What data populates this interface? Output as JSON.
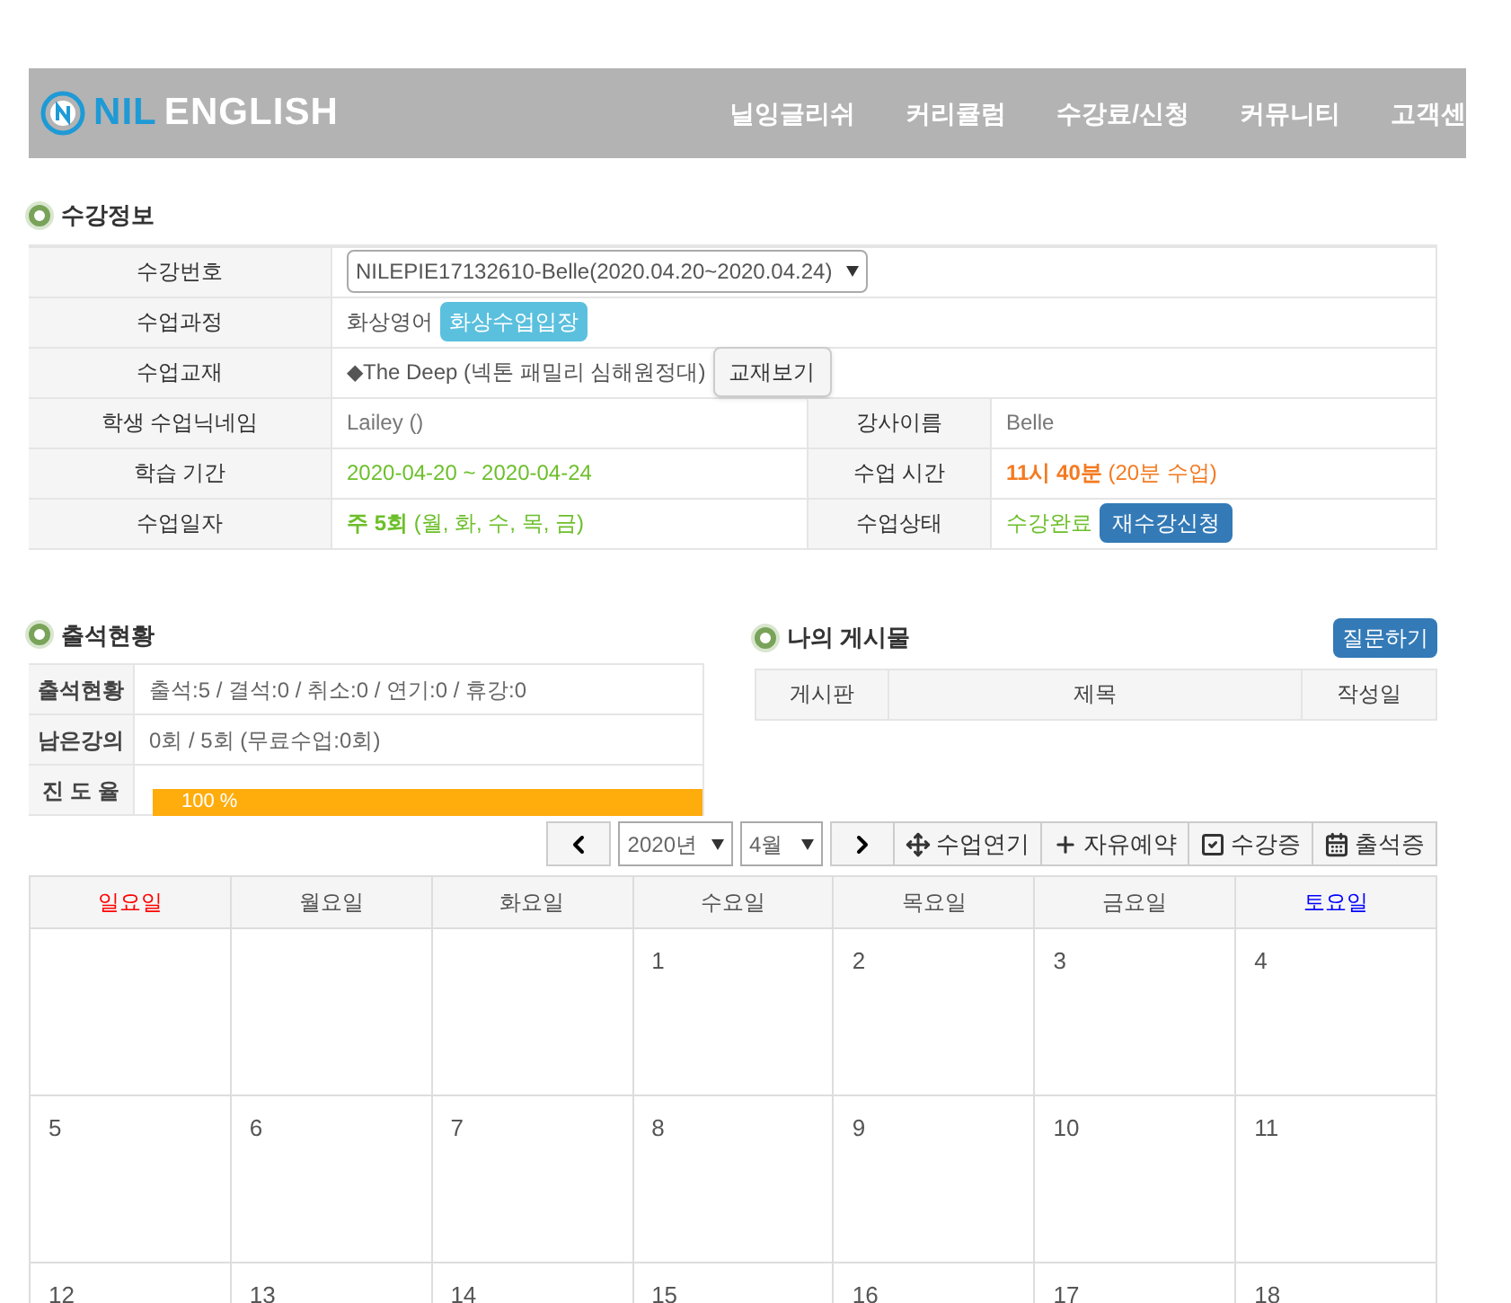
{
  "header": {
    "logo": {
      "brand": "NIL",
      "name": "ENGLISH"
    },
    "nav": [
      {
        "label": "닐잉글리쉬"
      },
      {
        "label": "커리큘럼"
      },
      {
        "label": "수강료/신청"
      },
      {
        "label": "커뮤니티"
      },
      {
        "label": "고객센"
      }
    ]
  },
  "course_info": {
    "title": "수강정보",
    "rows": [
      {
        "cells": [
          {
            "label": "수강번호",
            "kind": "select",
            "value": "NILEPIE17132610-Belle(2020.04.20~2020.04.24)"
          }
        ]
      },
      {
        "cells": [
          {
            "label": "수업과정",
            "kind": "text",
            "value": "화상영어",
            "color": "#555555",
            "button": {
              "label": "화상수업입장",
              "kind": "cyan"
            }
          }
        ]
      },
      {
        "cells": [
          {
            "label": "수업교재",
            "kind": "text",
            "value": "◆The Deep (넥톤 패밀리 심해원정대)",
            "color": "#555555",
            "button": {
              "label": "교재보기",
              "kind": "plain"
            }
          }
        ]
      },
      {
        "cells": [
          {
            "label": "학생 수업닉네임",
            "kind": "text",
            "value": "Lailey ()",
            "color": "#777777"
          },
          {
            "label": "강사이름",
            "kind": "text",
            "value": "Belle",
            "color": "#777777"
          }
        ]
      },
      {
        "cells": [
          {
            "label": "학습 기간",
            "kind": "text",
            "value": "2020-04-20 ~ 2020-04-24",
            "color": "#6cbf2a"
          },
          {
            "label": "수업 시간",
            "kind": "text",
            "value": "**11시 40분** (20분 수업)",
            "color": "#f47a20"
          }
        ]
      },
      {
        "cells": [
          {
            "label": "수업일자",
            "kind": "text",
            "value": "**주 5회** (월, 화, 수, 목, 금)",
            "color": "#6cbf2a"
          },
          {
            "label": "수업상태",
            "kind": "text",
            "value": "수강완료",
            "color": "#6cbf2a",
            "button": {
              "label": "재수강신청",
              "kind": "blue"
            }
          }
        ]
      }
    ]
  },
  "attendance": {
    "title": "출석현황",
    "rows": [
      {
        "label": "출석현황",
        "kind": "text",
        "value": "출석:5 / 결석:0 / 취소:0 / 연기:0 / 휴강:0"
      },
      {
        "label": "남은강의",
        "kind": "text",
        "value": "0회 / 5회 (무료수업:0회)"
      },
      {
        "label": "진 도 율",
        "kind": "progress",
        "level": 1,
        "value": "100 %"
      }
    ]
  },
  "my_posts": {
    "title": "나의 게시물",
    "button": "질문하기",
    "columns": [
      "게시판",
      "제목",
      "작성일"
    ]
  },
  "toolbar": {
    "year": "2020년",
    "month": "4월",
    "buttons": [
      {
        "label": "수업연기"
      },
      {
        "label": "자유예약"
      },
      {
        "label": "수강증"
      },
      {
        "label": "출석증"
      }
    ]
  },
  "calendar": {
    "days": [
      {
        "label": "일요일",
        "color": "#ff0000"
      },
      {
        "label": "월요일",
        "color": "#555555"
      },
      {
        "label": "화요일",
        "color": "#555555"
      },
      {
        "label": "수요일",
        "color": "#555555"
      },
      {
        "label": "목요일",
        "color": "#555555"
      },
      {
        "label": "금요일",
        "color": "#555555"
      },
      {
        "label": "토요일",
        "color": "#0000ff"
      }
    ],
    "weeks": [
      [
        {
          "day": "1"
        },
        {
          "day": "2"
        },
        {
          "day": "3"
        },
        {
          "day": "4"
        }
      ],
      [
        {
          "day": "5"
        },
        {
          "day": "6"
        },
        {
          "day": "7"
        },
        {
          "day": "8"
        },
        {
          "day": "9"
        },
        {
          "day": "10"
        },
        {
          "day": "11"
        }
      ],
      [
        {
          "day": "12"
        },
        {
          "day": "13"
        },
        {
          "day": "14"
        },
        {
          "day": "15"
        },
        {
          "day": "16"
        },
        {
          "day": "17"
        },
        {
          "day": "18"
        }
      ]
    ]
  }
}
